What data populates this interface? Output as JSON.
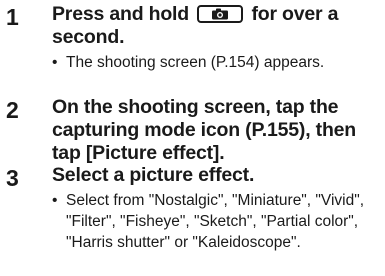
{
  "steps": [
    {
      "number": "1",
      "title_before_icon": "Press and hold",
      "icon": "camera-icon",
      "title_after_icon": "for over a second.",
      "note": "The shooting screen (P.154) appears."
    },
    {
      "number": "2",
      "title": "On the shooting screen, tap the capturing mode icon (P.155), then tap [Picture effect]."
    },
    {
      "number": "3",
      "title": "Select a picture effect.",
      "note": "Select from \"Nostalgic\", \"Miniature\", \"Vivid\", \"Filter\", \"Fisheye\", \"Sketch\", \"Partial color\", \"Harris shutter\" or \"Kaleidoscope\"."
    }
  ],
  "bullet_char": "•"
}
